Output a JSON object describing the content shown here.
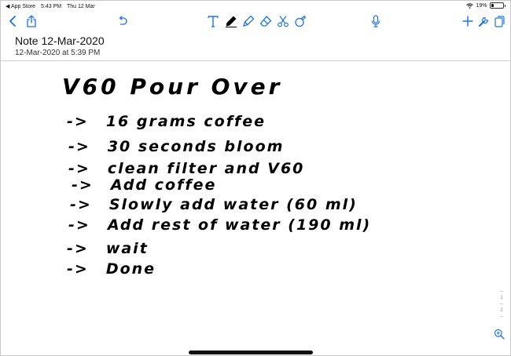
{
  "status_bar": {
    "back_app": "◀ App Store",
    "time": "5:43 PM",
    "date": "Thu 12 Mar",
    "battery_percent": "19%",
    "battery_level": 0.19
  },
  "toolbar": {
    "icons": {
      "back": "chevron-left-icon",
      "share": "share-icon",
      "undo": "undo-icon",
      "text": "text-tool-icon",
      "pen": "pen-icon",
      "highlighter": "highlighter-icon",
      "eraser": "eraser-icon",
      "scissors": "scissors-icon",
      "shape": "shape-tool-icon",
      "microphone": "microphone-icon",
      "add": "plus-icon",
      "tools": "wrench-icon",
      "pages": "pages-icon"
    },
    "accent_color": "#1a73e8",
    "active_color": "#000000"
  },
  "note": {
    "title": "Note 12-Mar-2020",
    "created": "12-Mar-2020 at 5:39 PM"
  },
  "handwriting": {
    "title": "V60 Pour Over",
    "lines": [
      {
        "arrow": "->",
        "text": "16 grams coffee"
      },
      {
        "arrow": "->",
        "text": "30 seconds bloom"
      },
      {
        "arrow": "->",
        "text": "clean filter and V60"
      },
      {
        "arrow": "->",
        "text": "Add coffee"
      },
      {
        "arrow": "->",
        "text": "Slowly add water (60 ml)"
      },
      {
        "arrow": "->",
        "text": "Add rest of water (190 ml)"
      },
      {
        "arrow": "->",
        "text": "wait"
      },
      {
        "arrow": "->",
        "text": "Done"
      }
    ]
  },
  "scroll_indicator": {
    "page_1": "1",
    "page_2": "2"
  },
  "zoom": {
    "icon": "zoom-in-icon"
  }
}
